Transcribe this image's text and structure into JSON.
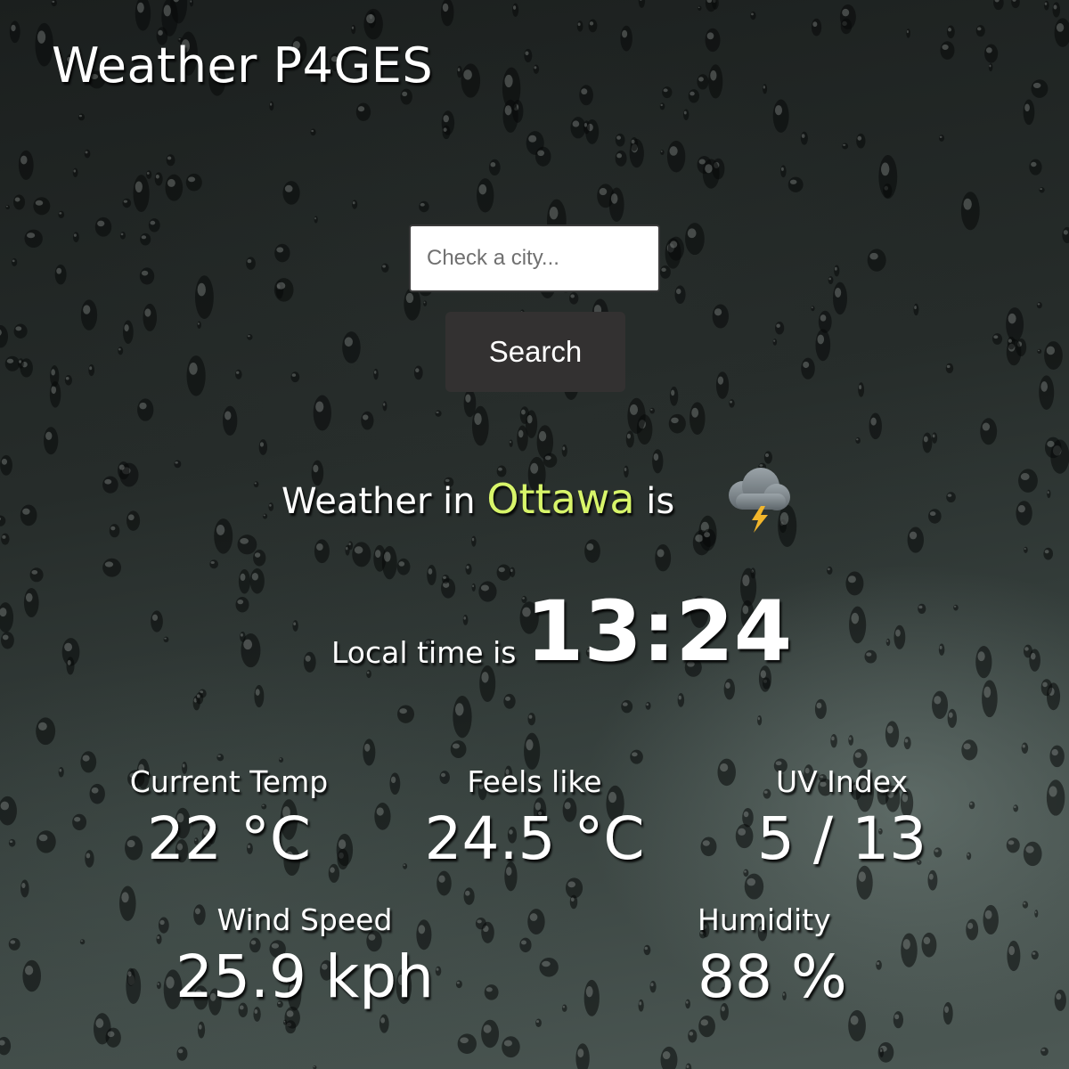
{
  "header": {
    "title": "Weather P4GES"
  },
  "search": {
    "placeholder": "Check a city...",
    "value": "",
    "button_label": "Search"
  },
  "weather": {
    "prefix": "Weather in ",
    "city": "Ottawa",
    "suffix": " is",
    "condition_icon": "thunderstorm-cloud-icon"
  },
  "local_time": {
    "label": "Local time is",
    "value": "13:24"
  },
  "stats": {
    "current_temp": {
      "label": "Current Temp",
      "value": "22 °C"
    },
    "feels_like": {
      "label": "Feels like",
      "value": "24.5 °C"
    },
    "uv_index": {
      "label": "UV Index",
      "value": "5 / 13"
    },
    "wind_speed": {
      "label": "Wind Speed",
      "value": "25.9 kph"
    },
    "humidity": {
      "label": "Humidity",
      "value": "88 %"
    }
  },
  "colors": {
    "accent_city": "#d8f56a",
    "button_bg": "#333131",
    "text": "#ffffff"
  }
}
